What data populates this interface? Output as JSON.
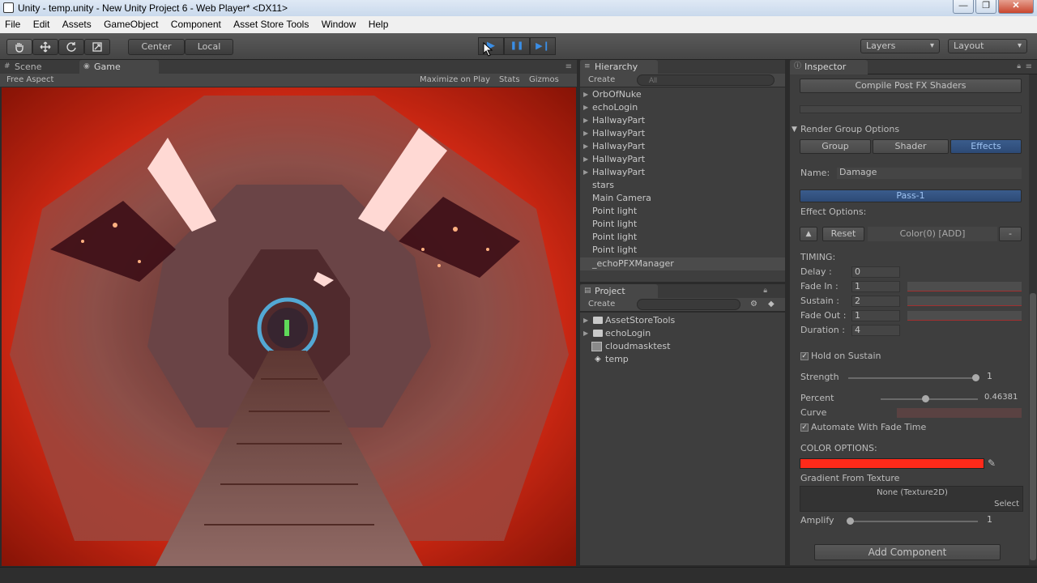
{
  "window": {
    "title": "Unity - temp.unity - New Unity Project 6 - Web Player* <DX11>",
    "controls": {
      "minimize": "—",
      "maximize": "❐",
      "close": "✕"
    }
  },
  "menu": [
    "File",
    "Edit",
    "Assets",
    "GameObject",
    "Component",
    "Asset Store Tools",
    "Window",
    "Help"
  ],
  "toolbar": {
    "tools": [
      "hand-icon",
      "move-icon",
      "rotate-icon",
      "scale-icon"
    ],
    "pivot_center": "Center",
    "pivot_local": "Local",
    "play": "▶",
    "pause": "❚❚",
    "step": "▶❙",
    "layers": "Layers",
    "layout": "Layout"
  },
  "scene_tab": "Scene",
  "game_tab": "Game",
  "game_bar": {
    "aspect": "Free Aspect",
    "maximize": "Maximize on Play",
    "stats": "Stats",
    "gizmos": "Gizmos"
  },
  "hierarchy": {
    "title": "Hierarchy",
    "create": "Create",
    "search_placeholder": "All",
    "items": [
      {
        "label": "OrbOfNuke",
        "arrow": "▶"
      },
      {
        "label": "echoLogin",
        "arrow": "▶"
      },
      {
        "label": "HallwayPart",
        "arrow": "▶"
      },
      {
        "label": "HallwayPart",
        "arrow": "▶"
      },
      {
        "label": "HallwayPart",
        "arrow": "▶"
      },
      {
        "label": "HallwayPart",
        "arrow": "▶"
      },
      {
        "label": "HallwayPart",
        "arrow": "▶"
      },
      {
        "label": "stars",
        "arrow": ""
      },
      {
        "label": "Main Camera",
        "arrow": ""
      },
      {
        "label": "Point light",
        "arrow": ""
      },
      {
        "label": "Point light",
        "arrow": ""
      },
      {
        "label": "Point light",
        "arrow": ""
      },
      {
        "label": "Point light",
        "arrow": ""
      },
      {
        "label": "_echoPFXManager",
        "arrow": ""
      }
    ]
  },
  "project": {
    "title": "Project",
    "create": "Create",
    "items": [
      {
        "label": "AssetStoreTools",
        "icon": "folder-icon",
        "arrow": "▶"
      },
      {
        "label": "echoLogin",
        "icon": "folder-icon",
        "arrow": "▶"
      },
      {
        "label": "cloudmasktest",
        "icon": "texture-icon",
        "arrow": ""
      },
      {
        "label": "temp",
        "icon": "unity-scene-icon",
        "arrow": ""
      }
    ]
  },
  "inspector": {
    "title": "Inspector",
    "compile_btn": "Compile Post FX Shaders",
    "render_group": "Render Group Options",
    "tabs": [
      "Group",
      "Shader",
      "Effects"
    ],
    "name_label": "Name:",
    "name_value": "Damage",
    "pass": "Pass-1",
    "effect_options": "Effect Options:",
    "up_btn": "▲",
    "reset_btn": "Reset",
    "color_add": "Color(0) [ADD]",
    "minus_btn": "-",
    "timing": "TIMING:",
    "timing_rows": [
      {
        "label": "Delay :",
        "value": "0"
      },
      {
        "label": "Fade In :",
        "value": "1"
      },
      {
        "label": "Sustain :",
        "value": "2"
      },
      {
        "label": "Fade Out :",
        "value": "1"
      },
      {
        "label": "Duration :",
        "value": "4"
      }
    ],
    "hold_on_sustain": "Hold on Sustain",
    "strength_label": "Strength",
    "strength_value": "1",
    "percent_label": "Percent",
    "percent_value": "0.46381",
    "curve_label": "Curve",
    "automate": "Automate With Fade Time",
    "color_options": "COLOR OPTIONS:",
    "color_swatch": "#ff2a1a",
    "gradient_label": "Gradient From Texture",
    "texture_none": "None (Texture2D)",
    "select": "Select",
    "amplify_label": "Amplify",
    "amplify_value": "1",
    "add_component": "Add Component"
  }
}
